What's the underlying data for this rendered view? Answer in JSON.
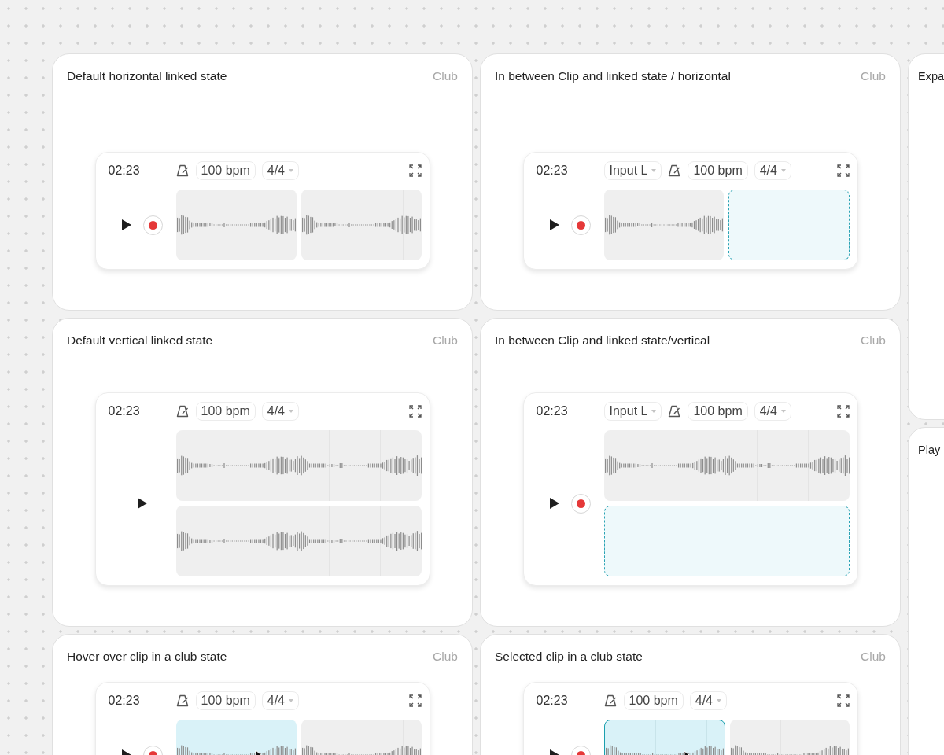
{
  "columns": [
    {
      "panels": [
        {
          "title": "Default horizontal linked state",
          "tag": "Club",
          "player": {
            "vertical": false,
            "time": "02:23",
            "bpm": "100 bpm",
            "meter": "4/4",
            "record": true,
            "clips": [
              {
                "kind": "clip",
                "hovered": false,
                "selected": false,
                "cursor": false
              },
              {
                "kind": "clip",
                "hovered": false,
                "selected": false,
                "cursor": false
              }
            ]
          }
        },
        {
          "title": "Default vertical linked state",
          "tag": "Club",
          "player": {
            "vertical": true,
            "time": "02:23",
            "bpm": "100 bpm",
            "meter": "4/4",
            "record": false,
            "clips": [
              {
                "kind": "clip",
                "hovered": false,
                "selected": false,
                "cursor": false
              },
              {
                "kind": "clip",
                "hovered": false,
                "selected": false,
                "cursor": false
              }
            ]
          }
        },
        {
          "title": "Hover over clip in a club state",
          "tag": "Club",
          "player": {
            "vertical": false,
            "time": "02:23",
            "bpm": "100 bpm",
            "meter": "4/4",
            "record": true,
            "clips": [
              {
                "kind": "clip",
                "hovered": true,
                "selected": false,
                "cursor": true
              },
              {
                "kind": "clip",
                "hovered": false,
                "selected": false,
                "cursor": false
              }
            ]
          }
        }
      ]
    },
    {
      "panels": [
        {
          "title": "In between Clip and linked state / horizontal",
          "tag": "Club",
          "player": {
            "vertical": false,
            "time": "02:23",
            "input": "Input L",
            "bpm": "100 bpm",
            "meter": "4/4",
            "record": true,
            "clips": [
              {
                "kind": "clip",
                "hovered": false,
                "selected": false,
                "cursor": false
              },
              {
                "kind": "placeholder"
              }
            ]
          }
        },
        {
          "title": "In between Clip and linked state/vertical",
          "tag": "Club",
          "player": {
            "vertical": true,
            "time": "02:23",
            "input": "Input L",
            "bpm": "100 bpm",
            "meter": "4/4",
            "record": true,
            "clips": [
              {
                "kind": "clip",
                "hovered": false,
                "selected": false,
                "cursor": false
              },
              {
                "kind": "placeholder"
              }
            ]
          }
        },
        {
          "title": "Selected clip in a club state",
          "tag": "Club",
          "player": {
            "vertical": false,
            "time": "02:23",
            "bpm": "100 bpm",
            "meter": "4/4",
            "record": true,
            "clips": [
              {
                "kind": "clip",
                "hovered": true,
                "selected": true,
                "cursor": true
              },
              {
                "kind": "clip",
                "hovered": false,
                "selected": false,
                "cursor": false
              }
            ]
          }
        }
      ]
    },
    {
      "panels": [
        {
          "title": "Expa"
        },
        {
          "title": "Play"
        }
      ]
    }
  ]
}
